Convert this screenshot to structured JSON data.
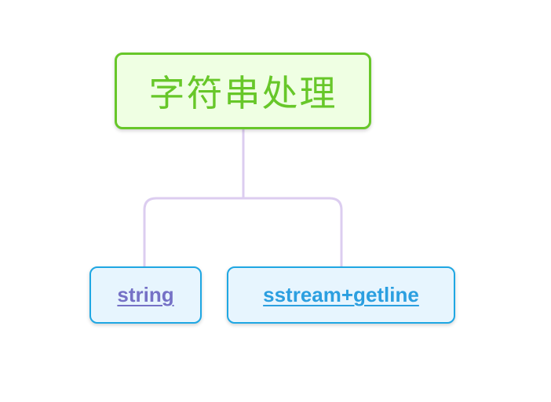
{
  "diagram": {
    "root": {
      "label": "字符串处理"
    },
    "children": [
      {
        "label": "string"
      },
      {
        "label": "sstream+getline"
      }
    ]
  },
  "colors": {
    "root_border": "#67c729",
    "root_fill": "#efffe3",
    "root_text": "#67c729",
    "child_border": "#1fa7e3",
    "child_fill": "#e7f5fe",
    "child_text_string": "#7571c6",
    "child_text_sstream": "#2b9fe0",
    "connector": "#dccdf0"
  }
}
